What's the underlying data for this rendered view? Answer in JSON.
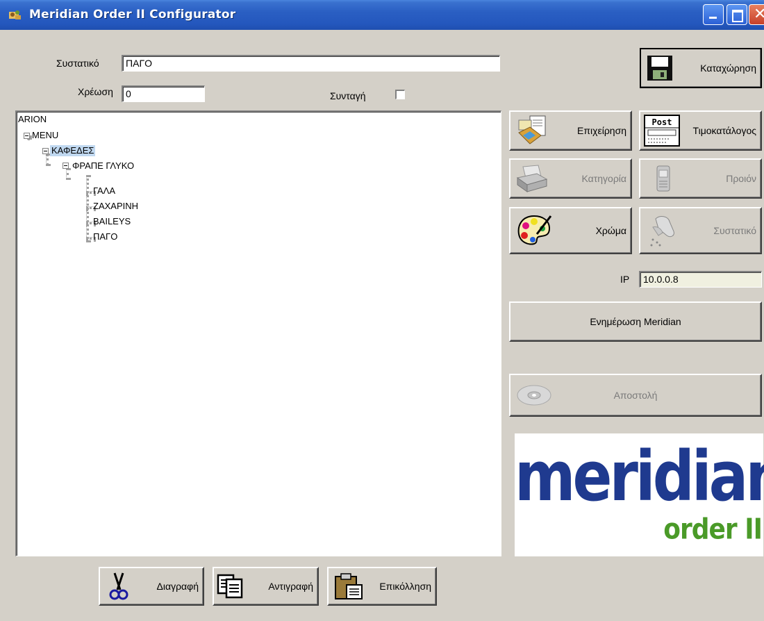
{
  "window": {
    "title": "Meridian Order II Configurator"
  },
  "form": {
    "ingredient_label": "Συστατικό",
    "ingredient_value": "ΠΑΓΟ",
    "charge_label": "Χρέωση",
    "charge_value": "0",
    "recipe_label": "Συνταγή",
    "recipe_checked": false
  },
  "tree": {
    "nodes": [
      "ARION",
      "MENU",
      "ΚΑΦΕΔΕΣ",
      "ΦΡΑΠΕ ΓΛΥΚΟ",
      "ΓΑΛΑ",
      "ΖΑΧΑΡΙΝΗ",
      "BAILEYS",
      "ΠΑΓΟ"
    ],
    "selected": "ΚΑΦΕΔΕΣ"
  },
  "buttons": {
    "save": "Καταχώρηση",
    "business": "Επιχείρηση",
    "pricelist": "Τιμοκατάλογος",
    "category": "Κατηγορία",
    "product": "Προιόν",
    "color": "Χρώμα",
    "ingredient": "Συστατικό",
    "update": "Ενημέρωση Meridian",
    "send": "Αποστολή",
    "delete": "Διαγραφή",
    "copy": "Αντιγραφή",
    "paste": "Επικόλληση"
  },
  "ip": {
    "label": "IP",
    "value": "10.0.0.8"
  },
  "logo": {
    "main": "meridian",
    "sub": "order II"
  },
  "icons": {
    "pricelist_badge": "Post"
  },
  "colors": {
    "titlebar": "#2457bd",
    "window_bg": "#d4d0c8",
    "logo_blue": "#1f3a8f",
    "logo_green": "#4a9a28",
    "selection": "#c0d8f0"
  }
}
